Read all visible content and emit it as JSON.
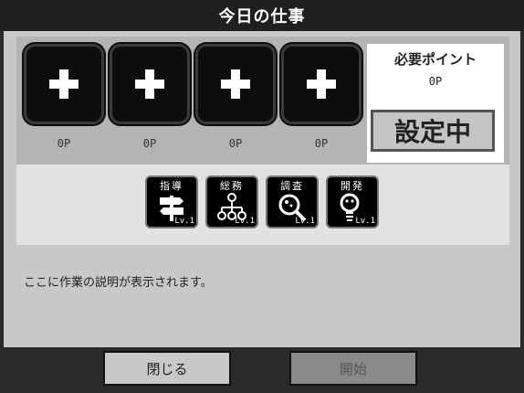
{
  "window": {
    "title": "今日の仕事"
  },
  "slots": [
    {
      "points": "0P"
    },
    {
      "points": "0P"
    },
    {
      "points": "0P"
    },
    {
      "points": "0P"
    }
  ],
  "requirement": {
    "label": "必要ポイント",
    "value": "0P",
    "status": "設定中"
  },
  "jobs": [
    {
      "name": "指導",
      "level": "Lv.1",
      "icon": "signpost-icon"
    },
    {
      "name": "総務",
      "level": "Lv.1",
      "icon": "org-chart-icon"
    },
    {
      "name": "調査",
      "level": "Lv.1",
      "icon": "magnifier-icon"
    },
    {
      "name": "開発",
      "level": "Lv.1",
      "icon": "lightbulb-icon"
    }
  ],
  "description": "ここに作業の説明が表示されます。",
  "buttons": {
    "close": "閉じる",
    "start": "開始"
  }
}
